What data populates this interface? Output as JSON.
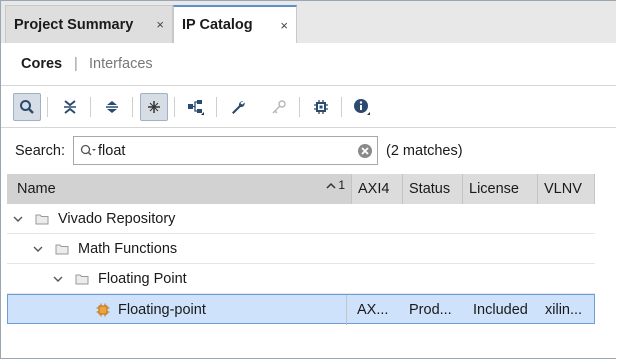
{
  "tabs": [
    {
      "label": "Project Summary",
      "close": "×"
    },
    {
      "label": "IP Catalog",
      "close": "×"
    }
  ],
  "subtabs": {
    "cores": "Cores",
    "separator": "|",
    "interfaces": "Interfaces"
  },
  "toolbar": {
    "icons": [
      "search-icon",
      "collapse-all-icon",
      "expand-all-icon",
      "filter-icon",
      "hierarchy-icon",
      "wrench-icon",
      "key-icon",
      "chip-icon",
      "info-icon"
    ]
  },
  "search": {
    "label": "Search:",
    "value": "float",
    "placeholder": "",
    "matches": "(2 matches)"
  },
  "table": {
    "columns": {
      "name": "Name",
      "sort_indicator": "1",
      "axi4": "AXI4",
      "status": "Status",
      "license": "License",
      "vlnv": "VLNV"
    },
    "rows": [
      {
        "name": "Vivado Repository",
        "axi4": "",
        "status": "",
        "license": "",
        "vlnv": ""
      },
      {
        "name": "Math Functions",
        "axi4": "",
        "status": "",
        "license": "",
        "vlnv": ""
      },
      {
        "name": "Floating Point",
        "axi4": "",
        "status": "",
        "license": "",
        "vlnv": ""
      },
      {
        "name": "Floating-point",
        "axi4": "AX...",
        "status": "Prod...",
        "license": "Included",
        "vlnv": "xilin..."
      }
    ]
  },
  "colors": {
    "selected_row": "#cfe2fb",
    "selected_border": "#6f9ed6",
    "active_tab_accent": "#5e8fc6",
    "header_bg": "#dcdcdc",
    "ip_core_icon": "#f0a33c"
  }
}
